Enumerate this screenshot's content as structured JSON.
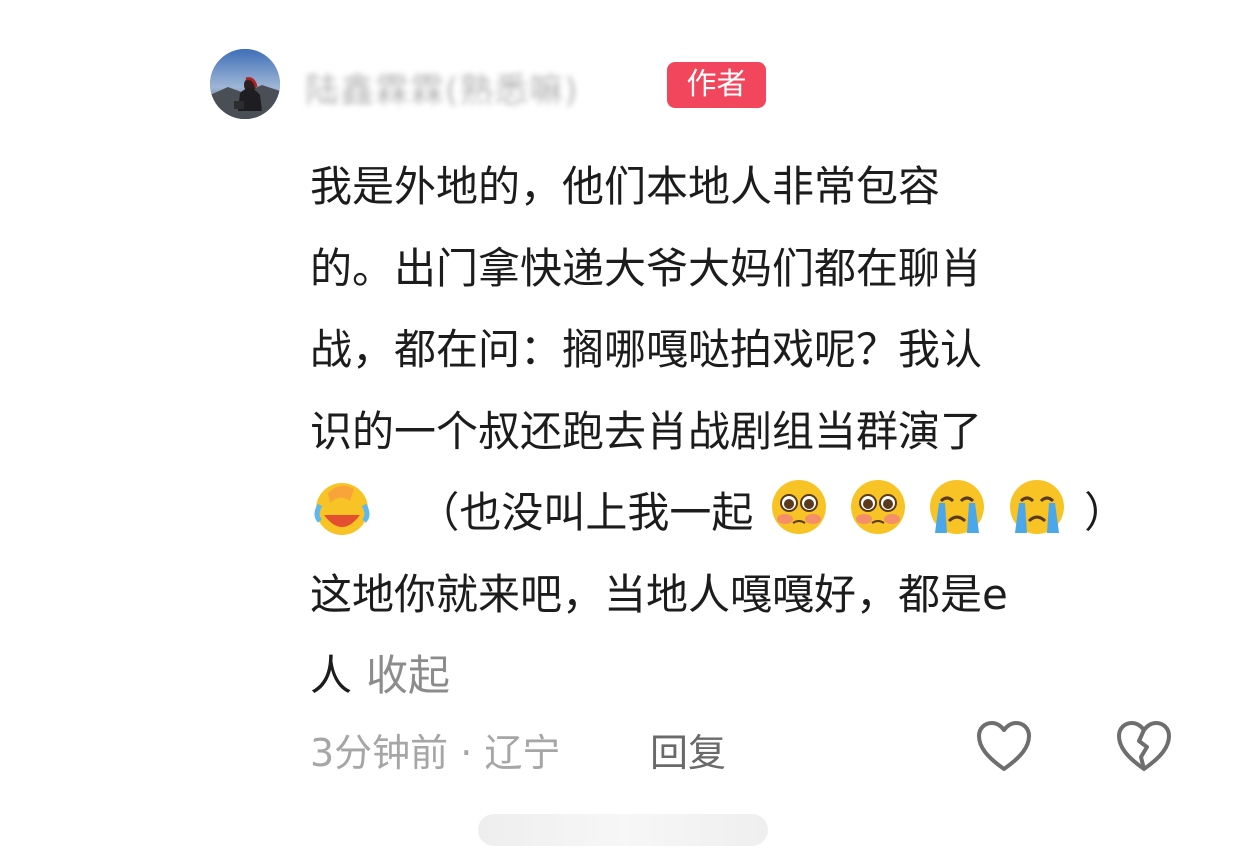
{
  "comment": {
    "username": "陆鑫霖霖(熟悉嘛)",
    "author_badge": "作者",
    "lines": [
      "我是外地的，他们本地人非常包容",
      "的。出门拿快递大爷大妈们都在聊肖",
      "战，都在问：搁哪嘎哒拍戏呢？我认",
      "识的一个叔还跑去肖战剧组当群演了"
    ],
    "line5_text": "（也没叫上我一起",
    "line5_close": "）",
    "line6": "这地你就来吧，当地人嘎嘎好，都是e",
    "line7": "人",
    "collapse_label": "收起",
    "emojis": [
      "laugh-cry-emoji",
      "pleading-emoji",
      "pleading-emoji",
      "crying-emoji",
      "crying-emoji"
    ]
  },
  "meta": {
    "time_location": "3分钟前 · 辽宁",
    "reply_label": "回复"
  },
  "icons": {
    "like": "heart-icon",
    "dislike": "broken-heart-icon"
  },
  "colors": {
    "badge": "#f2465d",
    "text": "#1c1c1c",
    "secondary": "#a6a6a6",
    "emoji": "#f7c325"
  }
}
